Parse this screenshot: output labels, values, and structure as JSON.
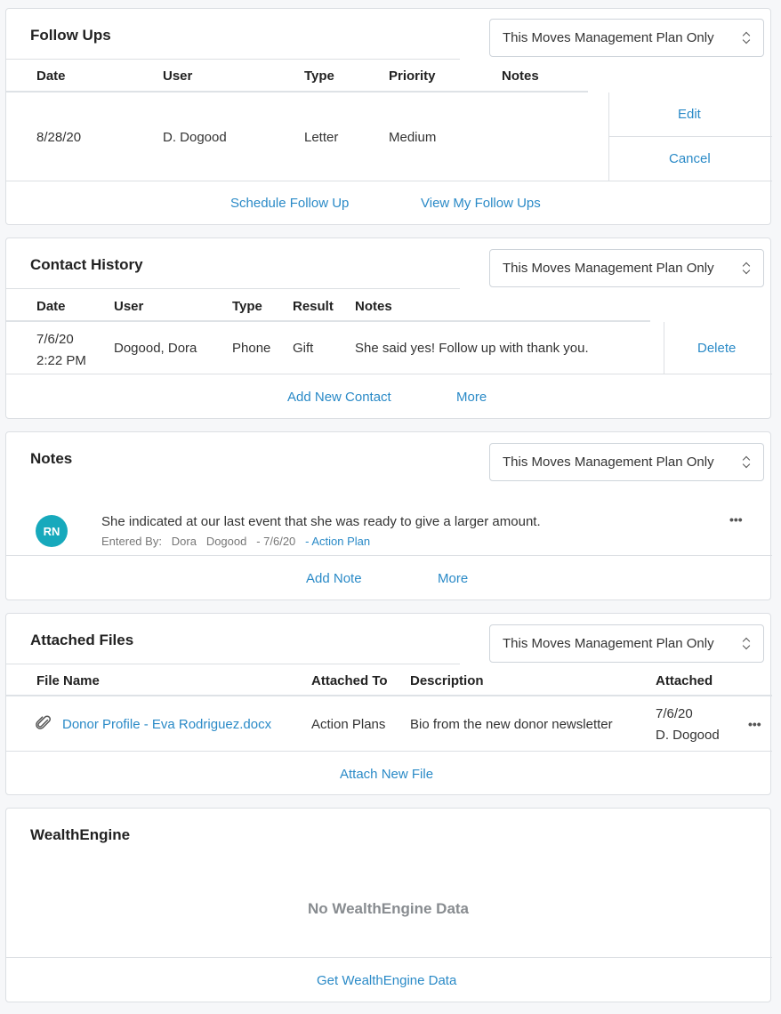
{
  "plan_filter_label": "This Moves Management Plan Only",
  "follow_ups": {
    "title": "Follow Ups",
    "headers": [
      "Date",
      "User",
      "Type",
      "Priority",
      "Notes"
    ],
    "row": {
      "date": "8/28/20",
      "user": "D. Dogood",
      "type": "Letter",
      "priority": "Medium",
      "notes": ""
    },
    "edit": "Edit",
    "cancel": "Cancel",
    "schedule": "Schedule Follow Up",
    "view_my": "View My Follow Ups"
  },
  "contact_history": {
    "title": "Contact History",
    "headers": [
      "Date",
      "User",
      "Type",
      "Result",
      "Notes"
    ],
    "row": {
      "date_line1": "7/6/20",
      "date_line2": "2:22 PM",
      "user": "Dogood, Dora",
      "type": "Phone",
      "result": "Gift",
      "notes": "She said yes! Follow up with thank you."
    },
    "delete": "Delete",
    "add_new": "Add New Contact",
    "more": "More"
  },
  "notes": {
    "title": "Notes",
    "avatar_initials": "RN",
    "text": "She indicated at our last event that she was ready to give a larger amount.",
    "entered_by_label": "Entered By:",
    "entered_by_first": "Dora",
    "entered_by_last": "Dogood",
    "date": "- 7/6/20",
    "source": "- Action Plan",
    "add_note": "Add Note",
    "more": "More"
  },
  "attached_files": {
    "title": "Attached Files",
    "headers": [
      "File Name",
      "Attached To",
      "Description",
      "Attached"
    ],
    "row": {
      "file_name": "Donor Profile - Eva Rodriguez.docx",
      "attached_to": "Action Plans",
      "description": "Bio from the new donor newsletter",
      "attached_date": "7/6/20",
      "attached_by": "D. Dogood"
    },
    "attach_new": "Attach New File"
  },
  "wealth_engine": {
    "title": "WealthEngine",
    "empty_message": "No WealthEngine Data",
    "get_data": "Get WealthEngine Data"
  },
  "colors": {
    "link": "#2a8ac7",
    "avatar": "#17a9bc",
    "background": "#f6f7f9"
  }
}
